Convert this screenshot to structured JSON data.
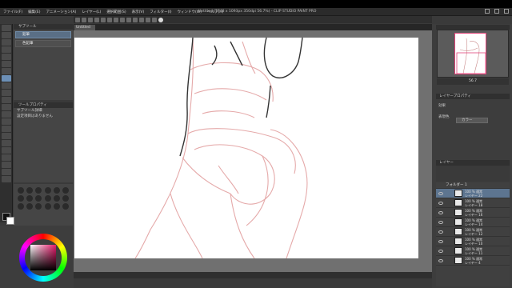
{
  "window": {
    "title": "Untitled (1748 x 1093px 350dpi 56.7%) - CLIP STUDIO PAINT PRO",
    "menu": [
      "ファイル(F)",
      "編集(E)",
      "アニメーション(A)",
      "レイヤー(L)",
      "選択範囲(S)",
      "表示(V)",
      "フィルター(I)",
      "ウィンドウ(W)",
      "ヘルプ(H)"
    ]
  },
  "canvas_tab": {
    "label": "Untitled"
  },
  "sub_tool": {
    "header": "サブツール",
    "items": [
      "鉛筆",
      "色鉛筆"
    ]
  },
  "tool_property": {
    "header": "ツールプロパティ",
    "subheader": "サブツール詳細",
    "rows": [
      "設定項目はありません"
    ]
  },
  "navigator": {
    "zoom": "56.7"
  },
  "sub_view": {
    "header": "レイヤープロパティ",
    "effect_label": "効果",
    "expression_label": "表現色",
    "expression_value": "カラー"
  },
  "layer_panel": {
    "header": "レイヤー",
    "folder": "フォルダー 1",
    "layers": [
      {
        "percent": "100 %",
        "mode": "通常",
        "name": "レイヤー 22",
        "selected": true
      },
      {
        "percent": "100 %",
        "mode": "通常",
        "name": "レイヤー 18",
        "selected": false
      },
      {
        "percent": "100 %",
        "mode": "通常",
        "name": "レイヤー 16",
        "selected": false
      },
      {
        "percent": "100 %",
        "mode": "通常",
        "name": "レイヤー 14",
        "selected": false
      },
      {
        "percent": "100 %",
        "mode": "通常",
        "name": "レイヤー 12",
        "selected": false
      },
      {
        "percent": "100 %",
        "mode": "通常",
        "name": "レイヤー 10",
        "selected": false
      },
      {
        "percent": "100 %",
        "mode": "通常",
        "name": "レイヤー 11",
        "selected": false
      },
      {
        "percent": "100 %",
        "mode": "通常",
        "name": "レイヤー 4",
        "selected": false
      }
    ]
  },
  "colors": {
    "accent": "#5d7590",
    "sketch": "#e0a0a0",
    "lineart": "#333333"
  }
}
